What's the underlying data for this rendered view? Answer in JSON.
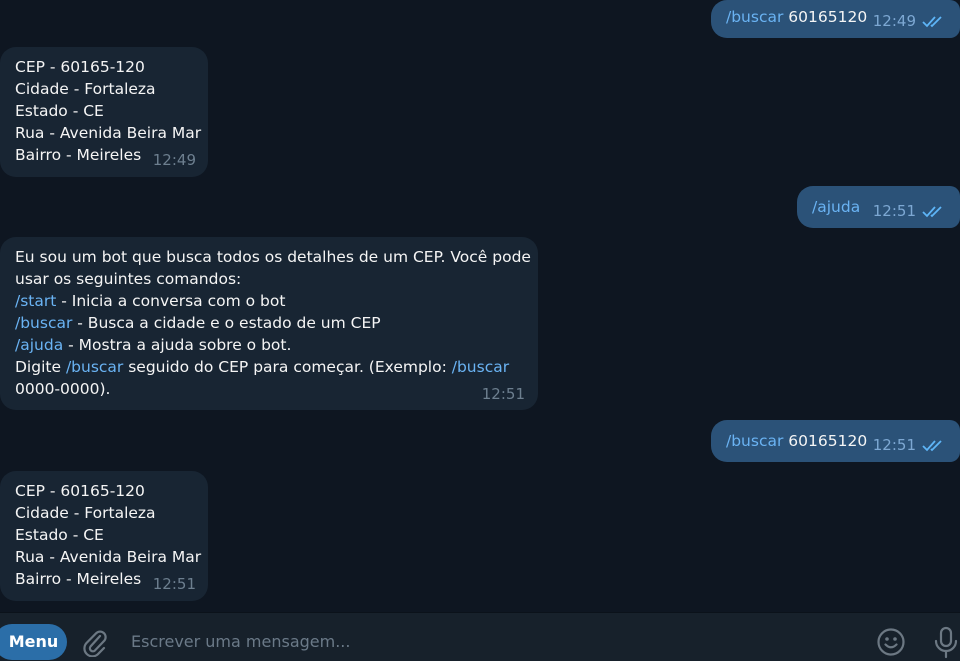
{
  "messages": [
    {
      "dir": "out",
      "parts": [
        {
          "cmd": "/buscar"
        },
        {
          "text": " 60165120"
        }
      ],
      "time": "12:49",
      "read": true
    },
    {
      "dir": "in",
      "lines": [
        "CEP - 60165-120",
        "Cidade - Fortaleza",
        "Estado - CE",
        "Rua - Avenida Beira Mar",
        "Bairro - Meireles"
      ],
      "time": "12:49"
    },
    {
      "dir": "out",
      "parts": [
        {
          "cmd": "/ajuda"
        }
      ],
      "time": "12:51",
      "read": true
    },
    {
      "dir": "in",
      "help": {
        "l1": "Eu sou um bot que busca todos os detalhes de um CEP. Você pode",
        "l2": "usar os seguintes comandos:",
        "start_cmd": "/start",
        "start_desc": " - Inicia a conversa com o bot",
        "buscar_cmd": "/buscar",
        "buscar_desc": " - Busca a cidade e o estado de um CEP",
        "ajuda_cmd": "/ajuda",
        "ajuda_desc": " - Mostra a ajuda sobre o bot.",
        "digite": "Digite ",
        "digite_cmd": "/buscar",
        "digite_rest": " seguido do CEP para começar. (Exemplo: ",
        "example_cmd": "/buscar",
        "last": "0000-0000)."
      },
      "time": "12:51"
    },
    {
      "dir": "out",
      "parts": [
        {
          "cmd": "/buscar"
        },
        {
          "text": " 60165120"
        }
      ],
      "time": "12:51",
      "read": true
    },
    {
      "dir": "in",
      "lines": [
        "CEP - 60165-120",
        "Cidade - Fortaleza",
        "Estado - CE",
        "Rua - Avenida Beira Mar",
        "Bairro - Meireles"
      ],
      "time": "12:51"
    }
  ],
  "composer": {
    "menu_label": "Menu",
    "placeholder": "Escrever uma mensagem...",
    "icons": {
      "attach": "paperclip-icon",
      "emoji": "emoji-icon",
      "voice": "microphone-icon"
    }
  },
  "colors": {
    "background": "#0e1621",
    "incoming_bubble": "#182533",
    "outgoing_bubble": "#2b5278",
    "command_link": "#6ab3f3",
    "menu_button": "#2b6ea8"
  }
}
